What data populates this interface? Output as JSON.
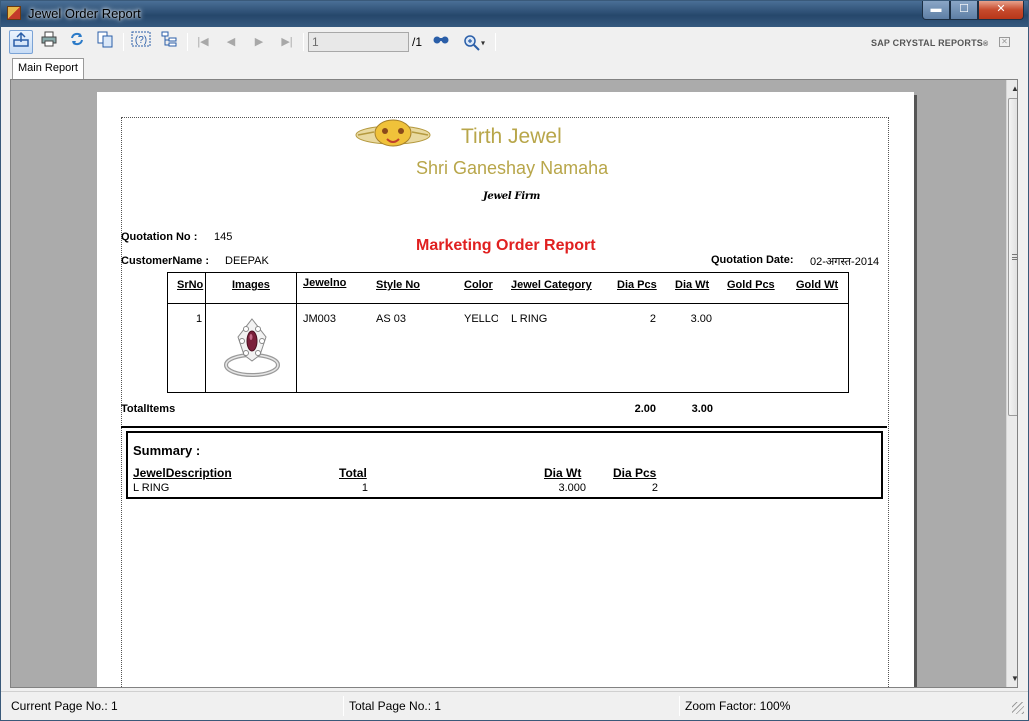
{
  "window": {
    "title": "Jewel Order Report",
    "buttons": {
      "minimize": "▬",
      "maximize": "☐",
      "close": "✕"
    }
  },
  "toolbar": {
    "icons": [
      "export-icon",
      "print-icon",
      "refresh-icon",
      "copy-icon",
      "help-icon",
      "group-tree-icon",
      "first-page-icon",
      "previous-page-icon",
      "next-page-icon",
      "last-page-icon",
      "find-icon",
      "zoom-icon"
    ],
    "page_input": "1",
    "page_total": "/1",
    "zoom_caret": "▾",
    "brand": "SAP CRYSTAL REPORTS",
    "brand_mark": "®",
    "brand_close": "✕"
  },
  "tabs": {
    "main": "Main Report"
  },
  "report": {
    "firm_name": "Tirth Jewel",
    "firm_subtitle": "Shri Ganeshay Namaha",
    "firm_tagline": "Jewel Firm",
    "quotation_no_label": "Quotation No :",
    "quotation_no": "145",
    "customer_label": "CustomerName :",
    "customer": "DEEPAK",
    "title": "Marketing Order Report",
    "quotation_date_label": "Quotation Date:",
    "quotation_date": "02-अगस्त-2014",
    "columns": [
      "SrNo",
      "Images",
      "Jewelno",
      "Style No",
      "Color",
      "Jewel Category",
      "Dia Pcs",
      "Dia Wt",
      "Gold Pcs",
      "Gold Wt"
    ],
    "rows": [
      {
        "srno": "1",
        "jewelno": "JM003",
        "style_no": "AS 03",
        "color": "YELLOW",
        "category": "L RING",
        "dia_pcs": "2",
        "dia_wt": "3.00",
        "gold_pcs": "",
        "gold_wt": ""
      }
    ],
    "total_items_label": "TotalItems",
    "total_dia_pcs": "2.00",
    "total_dia_wt": "3.00",
    "summary": {
      "title": "Summary :",
      "columns": [
        "JewelDescription",
        "Total",
        "Dia Wt",
        "Dia Pcs"
      ],
      "rows": [
        {
          "description": "L RING",
          "total": "1",
          "dia_wt": "3.000",
          "dia_pcs": "2"
        }
      ]
    }
  },
  "status": {
    "current_page": "Current Page No.: 1",
    "total_page": "Total Page No.: 1",
    "zoom": "Zoom Factor: 100%"
  },
  "colors": {
    "firm_gold": "#b8a64a",
    "title_red": "#e02020",
    "titlebar": "#2d4f74"
  }
}
